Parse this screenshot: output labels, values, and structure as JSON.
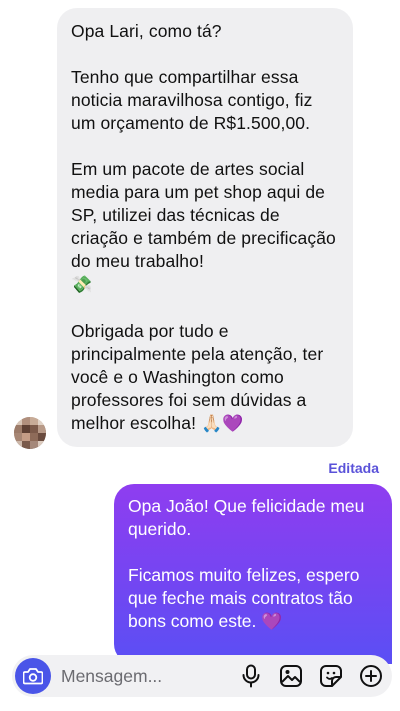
{
  "incoming_message": {
    "paragraphs": [
      "Opa Lari, como tá?",
      "Tenho que compartilhar essa noticia maravilhosa contigo, fiz um orçamento de R$1.500,00.",
      "Em um pacote de artes social media para um pet shop aqui de SP, utilizei das técnicas de criação e também de precificação do meu trabalho!",
      "Obrigada por tudo e principalmente pela atenção, ter você e o Washington como professores foi sem dúvidas a melhor escolha!"
    ],
    "emoji_money": "💸",
    "emoji_pray": "🙏🏻",
    "emoji_heart": "💜"
  },
  "edited_label": "Editada",
  "outgoing_message": {
    "paragraphs": [
      "Opa João! Que felicidade meu querido.",
      "Ficamos muito felizes, espero que feche mais contratos tão bons como este."
    ],
    "emoji_heart": "💜"
  },
  "composer": {
    "placeholder": "Mensagem...",
    "icons": [
      "camera-icon",
      "microphone-icon",
      "image-icon",
      "sticker-icon",
      "plus-icon"
    ]
  },
  "colors": {
    "incoming_bubble": "#efeff1",
    "outgoing_gradient_top": "#8f3df0",
    "outgoing_gradient_bottom": "#5a4ff4",
    "accent": "#5a52d9",
    "camera_button": "#4a55e8"
  }
}
